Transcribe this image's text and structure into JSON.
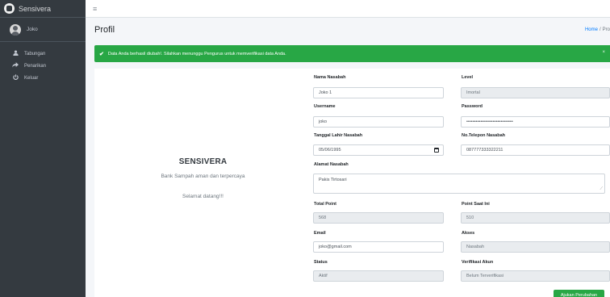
{
  "app": {
    "brand": "Sensivera"
  },
  "user": {
    "name": "Joko"
  },
  "sidebar": {
    "items": [
      {
        "label": "Tabungan",
        "icon": "user-icon"
      },
      {
        "label": "Penarikan",
        "icon": "share-arrow-icon"
      },
      {
        "label": "Keluar",
        "icon": "power-icon"
      }
    ]
  },
  "header": {
    "title": "Profil",
    "breadcrumb": {
      "home": "Home",
      "separator": "/",
      "current": "Pro"
    }
  },
  "alert": {
    "message": "Data Anda berhasil diubah!. Silahkan menunggu Pengurus untuk memverifikasi data Anda.",
    "close": "×",
    "color": "#28a745"
  },
  "intro": {
    "title": "SENSIVERA",
    "subtitle": "Bank Sampah aman dan terpercaya",
    "welcome": "Selamat datang!!!"
  },
  "form": {
    "nama": {
      "label": "Nama Nasabah",
      "value": "Joko 1"
    },
    "level": {
      "label": "Level",
      "value": "Imortal"
    },
    "username": {
      "label": "Username",
      "value": "joko"
    },
    "password": {
      "label": "Password",
      "value": "••••••••••••••••••••••••••••••"
    },
    "tanggal": {
      "label": "Tanggal Lahir Nasabah",
      "value": "05/06/1995"
    },
    "telepon": {
      "label": "No.Telepon Nasabah",
      "value": "087777333322211"
    },
    "alamat": {
      "label": "Alamat Nasabah",
      "value": "Pakis Tirtosari"
    },
    "total_point": {
      "label": "Total Point",
      "value": "568"
    },
    "point_saat_ini": {
      "label": "Point Saat Ini",
      "value": "510"
    },
    "email": {
      "label": "Email",
      "value": "joko@gmail.com"
    },
    "akses": {
      "label": "Akses",
      "value": "Nasabah"
    },
    "status": {
      "label": "Status",
      "value": "Aktif"
    },
    "verifikasi": {
      "label": "Verifikasi Akun",
      "value": "Belum Terverifikasi"
    },
    "submit_label": "Ajukan Perubahan"
  },
  "colors": {
    "sidebar": "#343a40",
    "success": "#28a745",
    "link": "#007bff"
  }
}
